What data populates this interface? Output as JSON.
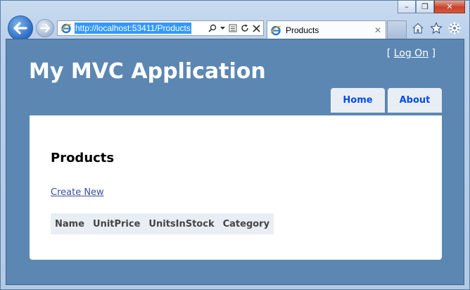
{
  "browser": {
    "address_url": "http://localhost:53411/Products",
    "tab_title": "Products",
    "tab_close_glyph": "✕",
    "caption_minimize": "–",
    "caption_maximize": "❐",
    "caption_close": "✕"
  },
  "site": {
    "title": "My MVC Application",
    "login_prefix": "[ ",
    "login_link": "Log On",
    "login_suffix": " ]",
    "menu": [
      {
        "label": "Home"
      },
      {
        "label": "About"
      }
    ]
  },
  "page": {
    "heading": "Products",
    "create_link": "Create New",
    "table": {
      "columns": [
        "Name",
        "UnitPrice",
        "UnitsInStock",
        "Category"
      ]
    }
  },
  "colors": {
    "page_background": "#5c87b2",
    "menu_link": "#034af3",
    "content_background": "#ffffff",
    "table_header": "#e8eef4"
  },
  "icons": [
    "back-arrow-icon",
    "forward-arrow-icon",
    "ie-logo-icon",
    "search-icon",
    "dropdown-icon",
    "compatibility-view-icon",
    "refresh-icon",
    "stop-icon",
    "home-icon",
    "favorites-star-icon",
    "gear-icon"
  ]
}
